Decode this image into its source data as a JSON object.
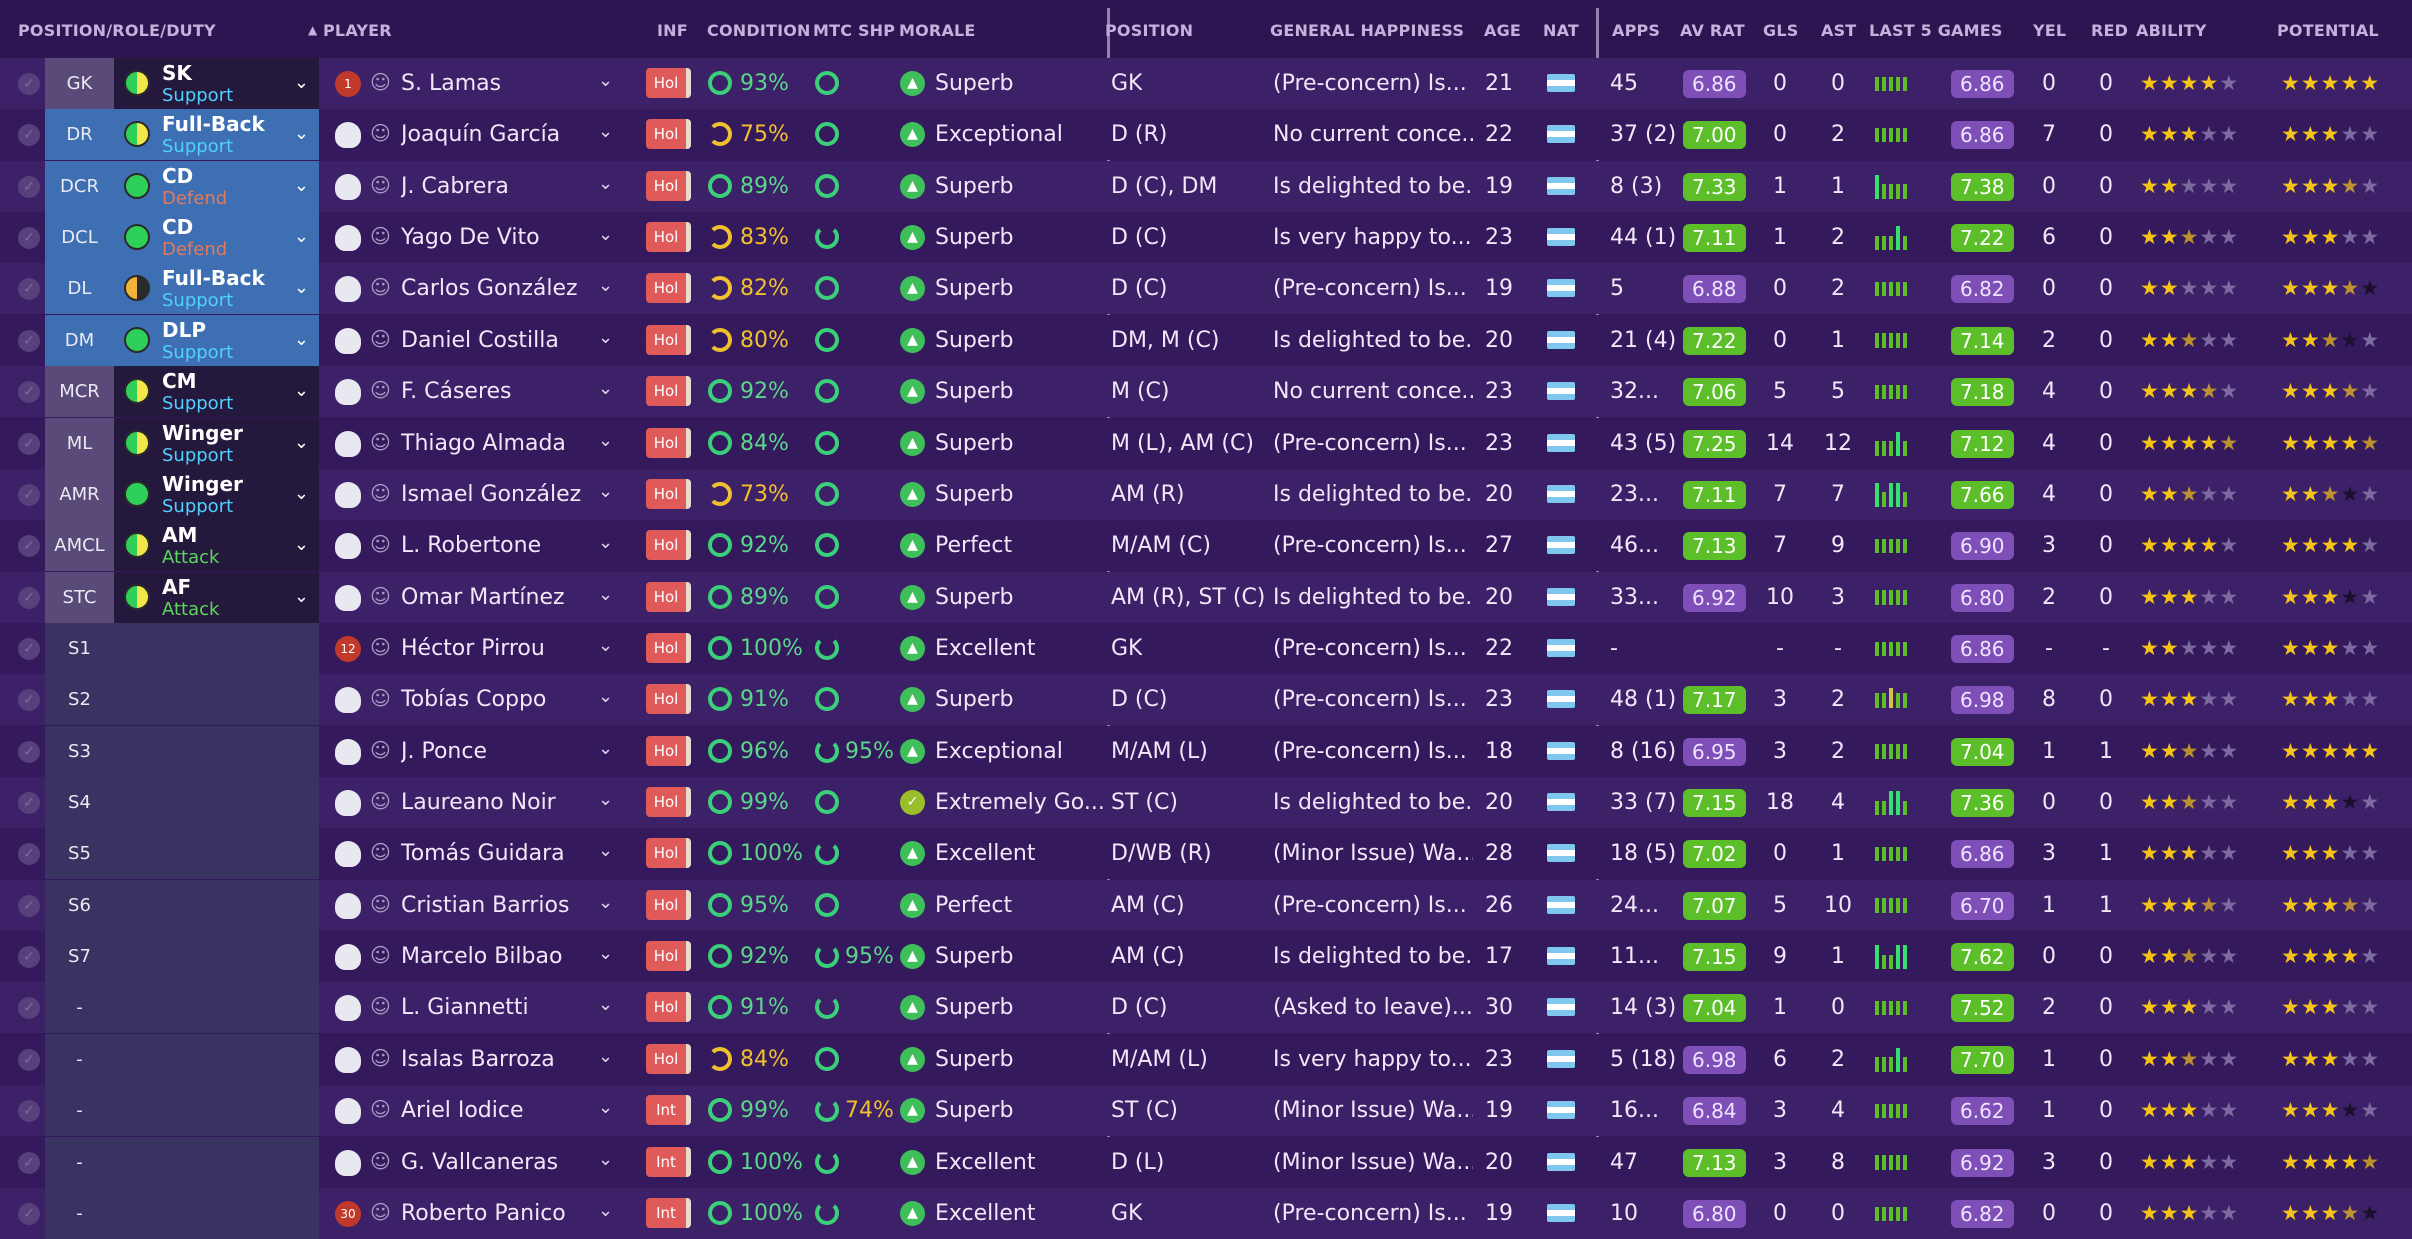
{
  "columns": {
    "position_role_duty": "POSITION/ROLE/DUTY",
    "player": "PLAYER",
    "inf": "INF",
    "condition": "CONDITION",
    "mtc_shp": "MTC SHP",
    "morale": "MORALE",
    "position": "POSITION",
    "general_happiness": "GENERAL HAPPINESS",
    "age": "AGE",
    "nat": "NAT",
    "apps": "APPS",
    "av_rat": "AV RAT",
    "gls": "GLS",
    "ast": "AST",
    "last5": "LAST 5 GAMES",
    "yel": "YEL",
    "red": "RED",
    "ability": "ABILITY",
    "potential": "POTENTIAL"
  },
  "sort_indicator": "▲",
  "colors": {
    "rating_good": "#5cbf2a",
    "rating_avg": "#7e4fb7",
    "inf_hot": "#e05a5a",
    "star": "#f6c319"
  },
  "rows": [
    {
      "pos": "GK",
      "role": "SK",
      "duty": "Support",
      "dutyColor": "#4fd1ff",
      "circle": "half-y",
      "name": "S. Lamas",
      "shirt": "1",
      "gk": true,
      "inf": "Hol",
      "cond": "93%",
      "condYel": false,
      "mtc": "",
      "mtcPart": false,
      "morale": "Superb",
      "morIc": "▲",
      "position": "GK",
      "happy": "(Pre-concern) Is...",
      "age": "21",
      "apps": "45",
      "avr": "6.86",
      "avrC": "p",
      "gls": "0",
      "ast": "0",
      "bars": [
        3,
        3,
        3,
        3,
        3
      ],
      "barsC": "#5cbf2a",
      "l5": "6.86",
      "l5C": "p",
      "yel": "0",
      "red": "0",
      "ab": 4,
      "abH": false,
      "pot": 5,
      "potH": false,
      "potDark": 1
    },
    {
      "pos": "DR",
      "role": "Full-Back",
      "duty": "Support",
      "dutyColor": "#4fd1ff",
      "circle": "half-y",
      "name": "Joaquín García",
      "shirt": "",
      "gk": false,
      "inf": "Hol",
      "cond": "75%",
      "condYel": true,
      "mtc": "",
      "mtcPart": false,
      "morale": "Exceptional",
      "morIc": "▲",
      "position": "D (R)",
      "happy": "No current conce...",
      "age": "22",
      "apps": "37 (2)",
      "avr": "7.00",
      "avrC": "g",
      "gls": "0",
      "ast": "2",
      "bars": [
        3,
        3,
        3,
        3,
        3
      ],
      "barsC": "#5cbf2a",
      "l5": "6.86",
      "l5C": "p",
      "yel": "7",
      "red": "0",
      "ab": 3,
      "abH": false,
      "pot": 3,
      "potH": false,
      "potDark": 0
    },
    {
      "pos": "DCR",
      "role": "CD",
      "duty": "Defend",
      "dutyColor": "#e07a5a",
      "circle": "green",
      "name": "J. Cabrera",
      "shirt": "",
      "gk": false,
      "inf": "Hol",
      "cond": "89%",
      "condYel": false,
      "mtc": "",
      "mtcPart": false,
      "morale": "Superb",
      "morIc": "▲",
      "position": "D (C), DM",
      "happy": "Is delighted to be...",
      "age": "19",
      "apps": "8 (3)",
      "avr": "7.33",
      "avrC": "g",
      "gls": "1",
      "ast": "1",
      "bars": [
        5,
        3,
        3,
        3,
        3
      ],
      "barsC": "#5cbf2a",
      "l5": "7.38",
      "l5C": "g",
      "yel": "0",
      "red": "0",
      "ab": 2,
      "abH": false,
      "pot": 3,
      "potH": true,
      "potDark": 0
    },
    {
      "pos": "DCL",
      "role": "CD",
      "duty": "Defend",
      "dutyColor": "#e07a5a",
      "circle": "green",
      "name": "Yago De Vito",
      "shirt": "",
      "gk": false,
      "inf": "Hol",
      "cond": "83%",
      "condYel": true,
      "mtc": "",
      "mtcPart": true,
      "morale": "Superb",
      "morIc": "▲",
      "position": "D (C)",
      "happy": "Is very happy to...",
      "age": "23",
      "apps": "44 (1)",
      "avr": "7.11",
      "avrC": "g",
      "gls": "1",
      "ast": "2",
      "bars": [
        3,
        3,
        3,
        5,
        3
      ],
      "barsC": "#5cbf2a",
      "l5": "7.22",
      "l5C": "g",
      "yel": "6",
      "red": "0",
      "ab": 2,
      "abH": true,
      "pot": 3,
      "potH": false,
      "potDark": 0
    },
    {
      "pos": "DL",
      "role": "Full-Back",
      "duty": "Support",
      "dutyColor": "#4fd1ff",
      "circle": "half-o",
      "name": "Carlos González",
      "shirt": "",
      "gk": false,
      "inf": "Hol",
      "cond": "82%",
      "condYel": true,
      "mtc": "",
      "mtcPart": false,
      "morale": "Superb",
      "morIc": "▲",
      "position": "D (C)",
      "happy": "(Pre-concern) Is...",
      "age": "19",
      "apps": "5",
      "avr": "6.88",
      "avrC": "p",
      "gls": "0",
      "ast": "2",
      "bars": [
        3,
        3,
        3,
        3,
        3
      ],
      "barsC": "#5cbf2a",
      "l5": "6.82",
      "l5C": "p",
      "yel": "0",
      "red": "0",
      "ab": 2,
      "abH": false,
      "pot": 3,
      "potH": true,
      "potDark": 1
    },
    {
      "pos": "DM",
      "role": "DLP",
      "duty": "Support",
      "dutyColor": "#4fd1ff",
      "circle": "green",
      "name": "Daniel Costilla",
      "shirt": "",
      "gk": false,
      "inf": "Hol",
      "cond": "80%",
      "condYel": true,
      "mtc": "",
      "mtcPart": false,
      "morale": "Superb",
      "morIc": "▲",
      "position": "DM, M (C)",
      "happy": "Is delighted to be...",
      "age": "20",
      "apps": "21 (4)",
      "avr": "7.22",
      "avrC": "g",
      "gls": "0",
      "ast": "1",
      "bars": [
        3,
        3,
        3,
        3,
        3
      ],
      "barsC": "#5cbf2a",
      "l5": "7.14",
      "l5C": "g",
      "yel": "2",
      "red": "0",
      "ab": 2,
      "abH": true,
      "pot": 2,
      "potH": true,
      "potDark": 1
    },
    {
      "pos": "MCR",
      "role": "CM",
      "duty": "Support",
      "dutyColor": "#4fd1ff",
      "circle": "half-y",
      "name": "F. Cáseres",
      "shirt": "",
      "gk": false,
      "inf": "Hol",
      "cond": "92%",
      "condYel": false,
      "mtc": "",
      "mtcPart": false,
      "morale": "Superb",
      "morIc": "▲",
      "position": "M (C)",
      "happy": "No current conce...",
      "age": "23",
      "apps": "32...",
      "avr": "7.06",
      "avrC": "g",
      "gls": "5",
      "ast": "5",
      "bars": [
        3,
        3,
        3,
        3,
        3
      ],
      "barsC": "#5cbf2a",
      "l5": "7.18",
      "l5C": "g",
      "yel": "4",
      "red": "0",
      "ab": 3,
      "abH": true,
      "pot": 3,
      "potH": true,
      "potDark": 0
    },
    {
      "pos": "ML",
      "role": "Winger",
      "duty": "Support",
      "dutyColor": "#4fd1ff",
      "circle": "half-y",
      "name": "Thiago Almada",
      "shirt": "",
      "gk": false,
      "inf": "Hol",
      "cond": "84%",
      "condYel": false,
      "mtc": "",
      "mtcPart": false,
      "morale": "Superb",
      "morIc": "▲",
      "position": "M (L), AM (C)",
      "happy": "(Pre-concern) Is...",
      "age": "23",
      "apps": "43 (5)",
      "avr": "7.25",
      "avrC": "g",
      "gls": "14",
      "ast": "12",
      "bars": [
        3,
        3,
        3,
        5,
        3
      ],
      "barsC": "#5cbf2a",
      "l5": "7.12",
      "l5C": "g",
      "yel": "4",
      "red": "0",
      "ab": 4,
      "abH": true,
      "pot": 4,
      "potH": true,
      "potDark": 0
    },
    {
      "pos": "AMR",
      "role": "Winger",
      "duty": "Support",
      "dutyColor": "#4fd1ff",
      "circle": "green",
      "name": "Ismael González",
      "shirt": "",
      "gk": false,
      "inf": "Hol",
      "cond": "73%",
      "condYel": true,
      "mtc": "",
      "mtcPart": false,
      "morale": "Superb",
      "morIc": "▲",
      "position": "AM (R)",
      "happy": "Is delighted to be...",
      "age": "20",
      "apps": "23...",
      "avr": "7.11",
      "avrC": "g",
      "gls": "7",
      "ast": "7",
      "bars": [
        5,
        3,
        5,
        5,
        3
      ],
      "barsC": "#5cbf2a",
      "l5": "7.66",
      "l5C": "g",
      "yel": "4",
      "red": "0",
      "ab": 2,
      "abH": true,
      "pot": 2,
      "potH": true,
      "potDark": 1
    },
    {
      "pos": "AMCL",
      "role": "AM",
      "duty": "Attack",
      "dutyColor": "#5cd65c",
      "circle": "half-y",
      "name": "L. Robertone",
      "shirt": "",
      "gk": false,
      "inf": "Hol",
      "cond": "92%",
      "condYel": false,
      "mtc": "",
      "mtcPart": false,
      "morale": "Perfect",
      "morIc": "▲",
      "position": "M/AM (C)",
      "happy": "(Pre-concern) Is...",
      "age": "27",
      "apps": "46...",
      "avr": "7.13",
      "avrC": "g",
      "gls": "7",
      "ast": "9",
      "bars": [
        3,
        3,
        3,
        3,
        3
      ],
      "barsC": "#5cbf2a",
      "l5": "6.90",
      "l5C": "p",
      "yel": "3",
      "red": "0",
      "ab": 4,
      "abH": false,
      "pot": 4,
      "potH": false,
      "potDark": 0
    },
    {
      "pos": "STC",
      "role": "AF",
      "duty": "Attack",
      "dutyColor": "#5cd65c",
      "circle": "half-y",
      "name": "Omar Martínez",
      "shirt": "",
      "gk": false,
      "inf": "Hol",
      "cond": "89%",
      "condYel": false,
      "mtc": "",
      "mtcPart": false,
      "morale": "Superb",
      "morIc": "▲",
      "position": "AM (R), ST (C)",
      "happy": "Is delighted to be...",
      "age": "20",
      "apps": "33...",
      "avr": "6.92",
      "avrC": "p",
      "gls": "10",
      "ast": "3",
      "bars": [
        3,
        3,
        3,
        3,
        3
      ],
      "barsC": "#5cbf2a",
      "l5": "6.80",
      "l5C": "p",
      "yel": "2",
      "red": "0",
      "ab": 3,
      "abH": false,
      "pot": 3,
      "potH": false,
      "potDark": 1
    },
    {
      "pos": "S1",
      "role": "",
      "duty": "",
      "dutyColor": "",
      "circle": "",
      "name": "Héctor Pirrou",
      "shirt": "12",
      "gk": true,
      "inf": "Hol",
      "cond": "100%",
      "condYel": false,
      "mtc": "",
      "mtcPart": true,
      "morale": "Excellent",
      "morIc": "▲",
      "position": "GK",
      "happy": "(Pre-concern) Is...",
      "age": "22",
      "apps": "-",
      "avr": "",
      "avrC": "",
      "gls": "-",
      "ast": "-",
      "bars": [
        3,
        3,
        3,
        3,
        3
      ],
      "barsC": "#5cbf2a",
      "l5": "6.86",
      "l5C": "p",
      "yel": "-",
      "red": "-",
      "ab": 2,
      "abH": false,
      "pot": 3,
      "potH": false,
      "potDark": 0
    },
    {
      "pos": "S2",
      "role": "",
      "duty": "",
      "dutyColor": "",
      "circle": "",
      "name": "Tobías Coppo",
      "shirt": "",
      "gk": false,
      "inf": "Hol",
      "cond": "91%",
      "condYel": false,
      "mtc": "",
      "mtcPart": false,
      "morale": "Superb",
      "morIc": "▲",
      "position": "D (C)",
      "happy": "(Pre-concern) Is...",
      "age": "23",
      "apps": "48 (1)",
      "avr": "7.17",
      "avrC": "g",
      "gls": "3",
      "ast": "2",
      "bars": [
        3,
        3,
        4,
        3,
        3
      ],
      "barsC": "#5cbf2a",
      "l5": "6.98",
      "l5C": "p",
      "yel": "8",
      "red": "0",
      "ab": 3,
      "abH": false,
      "pot": 3,
      "potH": false,
      "potDark": 0
    },
    {
      "pos": "S3",
      "role": "",
      "duty": "",
      "dutyColor": "",
      "circle": "",
      "name": "J. Ponce",
      "shirt": "",
      "gk": false,
      "inf": "Hol",
      "cond": "96%",
      "condYel": false,
      "mtc": "95%",
      "mtcPart": true,
      "morale": "Exceptional",
      "morIc": "▲",
      "position": "M/AM (L)",
      "happy": "(Pre-concern) Is...",
      "age": "18",
      "apps": "8 (16)",
      "avr": "6.95",
      "avrC": "p",
      "gls": "3",
      "ast": "2",
      "bars": [
        3,
        3,
        3,
        3,
        3
      ],
      "barsC": "#5cbf2a",
      "l5": "7.04",
      "l5C": "g",
      "yel": "1",
      "red": "1",
      "ab": 2,
      "abH": true,
      "pot": 5,
      "potH": false,
      "potDark": 0
    },
    {
      "pos": "S4",
      "role": "",
      "duty": "",
      "dutyColor": "",
      "circle": "",
      "name": "Laureano Noir",
      "shirt": "",
      "gk": false,
      "inf": "Hol",
      "cond": "99%",
      "condYel": false,
      "mtc": "",
      "mtcPart": false,
      "morale": "Extremely Go...",
      "morIc": "✓",
      "position": "ST (C)",
      "happy": "Is delighted to be...",
      "age": "20",
      "apps": "33 (7)",
      "avr": "7.15",
      "avrC": "g",
      "gls": "18",
      "ast": "4",
      "bars": [
        3,
        3,
        5,
        5,
        3
      ],
      "barsC": "#5cbf2a",
      "l5": "7.36",
      "l5C": "g",
      "yel": "0",
      "red": "0",
      "ab": 2,
      "abH": true,
      "pot": 3,
      "potH": false,
      "potDark": 1
    },
    {
      "pos": "S5",
      "role": "",
      "duty": "",
      "dutyColor": "",
      "circle": "",
      "name": "Tomás Guidara",
      "shirt": "",
      "gk": false,
      "inf": "Hol",
      "cond": "100%",
      "condYel": false,
      "mtc": "",
      "mtcPart": true,
      "morale": "Excellent",
      "morIc": "▲",
      "position": "D/WB (R)",
      "happy": "(Minor Issue) Wa...",
      "age": "28",
      "apps": "18 (5)",
      "avr": "7.02",
      "avrC": "g",
      "gls": "0",
      "ast": "1",
      "bars": [
        3,
        3,
        3,
        3,
        3
      ],
      "barsC": "#5cbf2a",
      "l5": "6.86",
      "l5C": "p",
      "yel": "3",
      "red": "1",
      "ab": 3,
      "abH": false,
      "pot": 3,
      "potH": false,
      "potDark": 0
    },
    {
      "pos": "S6",
      "role": "",
      "duty": "",
      "dutyColor": "",
      "circle": "",
      "name": "Cristian Barrios",
      "shirt": "",
      "gk": false,
      "inf": "Hol",
      "cond": "95%",
      "condYel": false,
      "mtc": "",
      "mtcPart": false,
      "morale": "Perfect",
      "morIc": "▲",
      "position": "AM (C)",
      "happy": "(Pre-concern) Is...",
      "age": "26",
      "apps": "24...",
      "avr": "7.07",
      "avrC": "g",
      "gls": "5",
      "ast": "10",
      "bars": [
        3,
        3,
        3,
        3,
        3
      ],
      "barsC": "#5cbf2a",
      "l5": "6.70",
      "l5C": "p",
      "yel": "1",
      "red": "1",
      "ab": 3,
      "abH": true,
      "pot": 3,
      "potH": true,
      "potDark": 0
    },
    {
      "pos": "S7",
      "role": "",
      "duty": "",
      "dutyColor": "",
      "circle": "",
      "name": "Marcelo Bilbao",
      "shirt": "",
      "gk": false,
      "inf": "Hol",
      "cond": "92%",
      "condYel": false,
      "mtc": "95%",
      "mtcPart": true,
      "morale": "Superb",
      "morIc": "▲",
      "position": "AM (C)",
      "happy": "Is delighted to be...",
      "age": "17",
      "apps": "11...",
      "avr": "7.15",
      "avrC": "g",
      "gls": "9",
      "ast": "1",
      "bars": [
        5,
        3,
        3,
        5,
        5
      ],
      "barsC": "#5cbf2a",
      "l5": "7.62",
      "l5C": "g",
      "yel": "0",
      "red": "0",
      "ab": 2,
      "abH": true,
      "pot": 4,
      "potH": false,
      "potDark": 0
    },
    {
      "pos": "-",
      "role": "",
      "duty": "",
      "dutyColor": "",
      "circle": "",
      "name": "L. Giannetti",
      "shirt": "",
      "gk": false,
      "inf": "Hol",
      "cond": "91%",
      "condYel": false,
      "mtc": "",
      "mtcPart": true,
      "morale": "Superb",
      "morIc": "▲",
      "position": "D (C)",
      "happy": "(Asked to leave)...",
      "age": "30",
      "apps": "14 (3)",
      "avr": "7.04",
      "avrC": "g",
      "gls": "1",
      "ast": "0",
      "bars": [
        3,
        3,
        3,
        3,
        3
      ],
      "barsC": "#5cbf2a",
      "l5": "7.52",
      "l5C": "g",
      "yel": "2",
      "red": "0",
      "ab": 3,
      "abH": false,
      "pot": 3,
      "potH": false,
      "potDark": 0
    },
    {
      "pos": "-",
      "role": "",
      "duty": "",
      "dutyColor": "",
      "circle": "",
      "name": "Isalas Barroza",
      "shirt": "",
      "gk": false,
      "inf": "Hol",
      "cond": "84%",
      "condYel": true,
      "mtc": "",
      "mtcPart": false,
      "morale": "Superb",
      "morIc": "▲",
      "position": "M/AM (L)",
      "happy": "Is very happy to...",
      "age": "23",
      "apps": "5 (18)",
      "avr": "6.98",
      "avrC": "p",
      "gls": "6",
      "ast": "2",
      "bars": [
        3,
        3,
        3,
        5,
        3
      ],
      "barsC": "#5cbf2a",
      "l5": "7.70",
      "l5C": "g",
      "yel": "1",
      "red": "0",
      "ab": 2,
      "abH": true,
      "pot": 3,
      "potH": false,
      "potDark": 0
    },
    {
      "pos": "-",
      "role": "",
      "duty": "",
      "dutyColor": "",
      "circle": "",
      "name": "Ariel Iodice",
      "shirt": "",
      "gk": false,
      "inf": "Int",
      "cond": "99%",
      "condYel": false,
      "mtc": "74%",
      "mtcPart": true,
      "morale": "Superb",
      "morIc": "▲",
      "position": "ST (C)",
      "happy": "(Minor Issue) Wa...",
      "age": "19",
      "apps": "16...",
      "avr": "6.84",
      "avrC": "p",
      "gls": "3",
      "ast": "4",
      "bars": [
        3,
        3,
        3,
        3,
        3
      ],
      "barsC": "#5cbf2a",
      "l5": "6.62",
      "l5C": "p",
      "yel": "1",
      "red": "0",
      "ab": 3,
      "abH": false,
      "pot": 3,
      "potH": false,
      "potDark": 1
    },
    {
      "pos": "-",
      "role": "",
      "duty": "",
      "dutyColor": "",
      "circle": "",
      "name": "G. Vallcaneras",
      "shirt": "",
      "gk": false,
      "inf": "Int",
      "cond": "100%",
      "condYel": false,
      "mtc": "",
      "mtcPart": true,
      "morale": "Excellent",
      "morIc": "▲",
      "position": "D (L)",
      "happy": "(Minor Issue) Wa...",
      "age": "20",
      "apps": "47",
      "avr": "7.13",
      "avrC": "g",
      "gls": "3",
      "ast": "8",
      "bars": [
        3,
        3,
        3,
        3,
        3
      ],
      "barsC": "#5cbf2a",
      "l5": "6.92",
      "l5C": "p",
      "yel": "3",
      "red": "0",
      "ab": 3,
      "abH": false,
      "pot": 4,
      "potH": true,
      "potDark": 0
    },
    {
      "pos": "-",
      "role": "",
      "duty": "",
      "dutyColor": "",
      "circle": "",
      "name": "Roberto Panico",
      "shirt": "30",
      "gk": true,
      "inf": "Int",
      "cond": "100%",
      "condYel": false,
      "mtc": "",
      "mtcPart": true,
      "morale": "Excellent",
      "morIc": "▲",
      "position": "GK",
      "happy": "(Pre-concern) Is...",
      "age": "19",
      "apps": "10",
      "avr": "6.80",
      "avrC": "p",
      "gls": "0",
      "ast": "0",
      "bars": [
        3,
        3,
        3,
        3,
        3
      ],
      "barsC": "#5cbf2a",
      "l5": "6.82",
      "l5C": "p",
      "yel": "0",
      "red": "0",
      "ab": 3,
      "abH": false,
      "pot": 3,
      "potH": true,
      "potDark": 1
    }
  ]
}
